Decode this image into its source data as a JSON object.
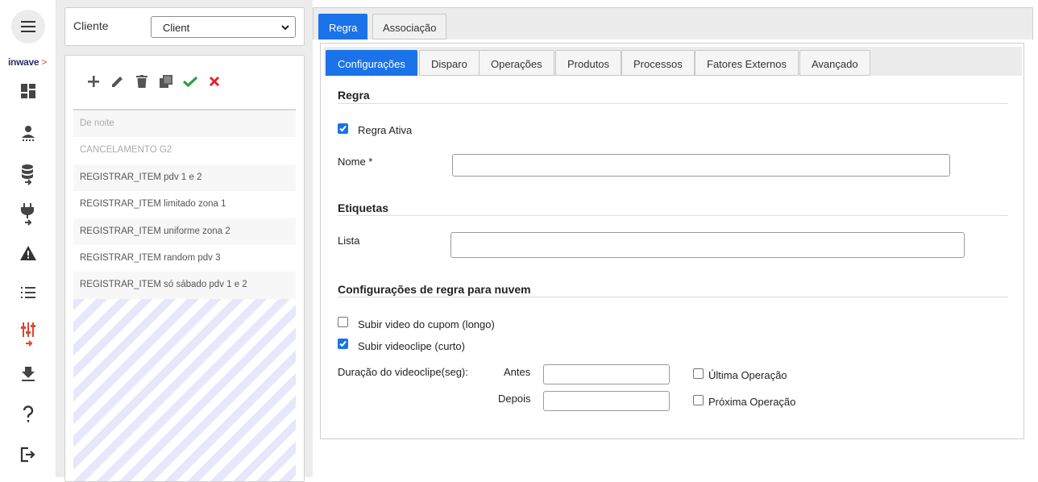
{
  "rail": {
    "logo_text": "inwave",
    "logo_mark": ">",
    "icons": [
      "menu-icon",
      "dashboard-icon",
      "users-icon",
      "database-export-icon",
      "plug-export-icon",
      "warning-icon",
      "list-icon",
      "tune-export-icon",
      "download-icon",
      "help-icon",
      "logout-icon"
    ],
    "accent_color": "#e0452b"
  },
  "client": {
    "label": "Cliente",
    "selected": "Client"
  },
  "toolbar": {
    "icons": [
      "add-icon",
      "edit-icon",
      "delete-icon",
      "copy-icon",
      "confirm-icon",
      "cancel-icon"
    ],
    "confirm_color": "#2e9e3e",
    "cancel_color": "#e0252b"
  },
  "rules": [
    {
      "label": "De noite",
      "dim": true
    },
    {
      "label": "CANCELAMENTO G2",
      "dim": true
    },
    {
      "label": "REGISTRAR_ITEM pdv 1 e 2",
      "dim": false
    },
    {
      "label": "REGISTRAR_ITEM limitado zona 1",
      "dim": false
    },
    {
      "label": "REGISTRAR_ITEM uniforme zona 2",
      "dim": false
    },
    {
      "label": "REGISTRAR_ITEM random pdv 3",
      "dim": false
    },
    {
      "label": "REGISTRAR_ITEM só sábado pdv 1 e 2",
      "dim": false
    }
  ],
  "outer_tabs": [
    {
      "label": "Regra",
      "active": true
    },
    {
      "label": "Associação",
      "active": false
    }
  ],
  "inner_tabs": [
    {
      "label": "Configurações",
      "active": true
    },
    {
      "label": "Disparo",
      "active": false
    },
    {
      "label": "Operações",
      "active": false
    },
    {
      "label": "Produtos",
      "active": false
    },
    {
      "label": "Processos",
      "active": false
    },
    {
      "label": "Fatores Externos",
      "active": false
    },
    {
      "label": "Avançado",
      "active": false
    }
  ],
  "form": {
    "section_regra": "Regra",
    "regra_ativa_label": "Regra Ativa",
    "regra_ativa_checked": true,
    "nome_label": "Nome *",
    "nome_value": "",
    "section_etiquetas": "Etiquetas",
    "lista_label": "Lista",
    "lista_value": "",
    "section_nuvem": "Configurações de regra para nuvem",
    "subir_video_label": "Subir video do cupom (longo)",
    "subir_video_checked": false,
    "subir_clipe_label": "Subir videoclipe (curto)",
    "subir_clipe_checked": true,
    "duracao_label": "Duração do videoclipe(seg):",
    "antes_label": "Antes",
    "antes_value": "",
    "depois_label": "Depois",
    "depois_value": "",
    "ultima_label": "Última Operação",
    "ultima_checked": false,
    "proxima_label": "Próxima Operação",
    "proxima_checked": false
  },
  "accent_color": "#1a73e8"
}
